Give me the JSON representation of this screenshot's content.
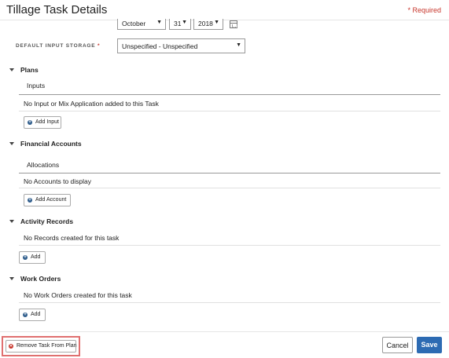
{
  "header": {
    "title": "Tillage Task Details",
    "required_note": "* Required"
  },
  "date": {
    "month": "October",
    "day": "31",
    "year": "2018",
    "calendar_icon": "calendar-icon"
  },
  "storage": {
    "label": "DEFAULT INPUT STORAGE",
    "required_star": "*",
    "value": "Unspecified - Unspecified"
  },
  "sections": {
    "plans": {
      "title": "Plans",
      "sub_label": "Inputs",
      "empty_message": "No Input or Mix Application added to this Task",
      "add_label": "Add Input"
    },
    "financial": {
      "title": "Financial Accounts",
      "sub_label": "Allocations",
      "empty_message": "No Accounts to display",
      "add_label": "Add Account"
    },
    "activity": {
      "title": "Activity Records",
      "empty_message": "No Records created for this task",
      "add_label": "Add"
    },
    "work_orders": {
      "title": "Work Orders",
      "empty_message": "No Work Orders created for this task",
      "add_label": "Add"
    }
  },
  "footer": {
    "remove_label": "Remove Task From Plan",
    "cancel_label": "Cancel",
    "save_label": "Save"
  },
  "colors": {
    "accent": "#2d6bb3",
    "required": "#c7352b",
    "highlight_border": "#e07070"
  }
}
